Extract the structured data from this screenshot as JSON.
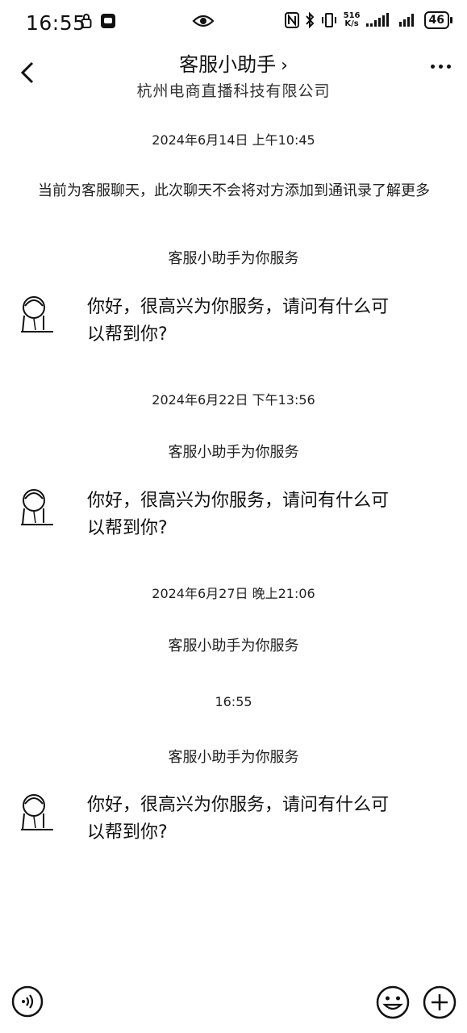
{
  "status_bar": {
    "time": "16:55",
    "net_speed_top": "516",
    "net_speed_bottom": "K/s",
    "battery": "46"
  },
  "header": {
    "title": "客服小助手",
    "subtitle": "杭州电商直播科技有限公司"
  },
  "chat": {
    "ts1": "2024年6月14日 上午10:45",
    "notice": "当前为客服聊天，此次聊天不会将对方添加到通讯录了解更多",
    "sys1": "客服小助手为你服务",
    "msg1": "你好，很高兴为你服务，请问有什么可以帮到你?",
    "ts2": "2024年6月22日 下午13:56",
    "sys2": "客服小助手为你服务",
    "msg2": "你好，很高兴为你服务，请问有什么可以帮到你?",
    "ts3": "2024年6月27日 晚上21:06",
    "sys3": "客服小助手为你服务",
    "ts4": "16:55",
    "sys4": "客服小助手为你服务",
    "msg3": "你好，很高兴为你服务，请问有什么可以帮到你?"
  },
  "icons": {
    "back": "chevron-left-icon",
    "more": "more-icon",
    "voice": "voice-icon",
    "emoji": "emoji-icon",
    "plus": "plus-icon"
  }
}
